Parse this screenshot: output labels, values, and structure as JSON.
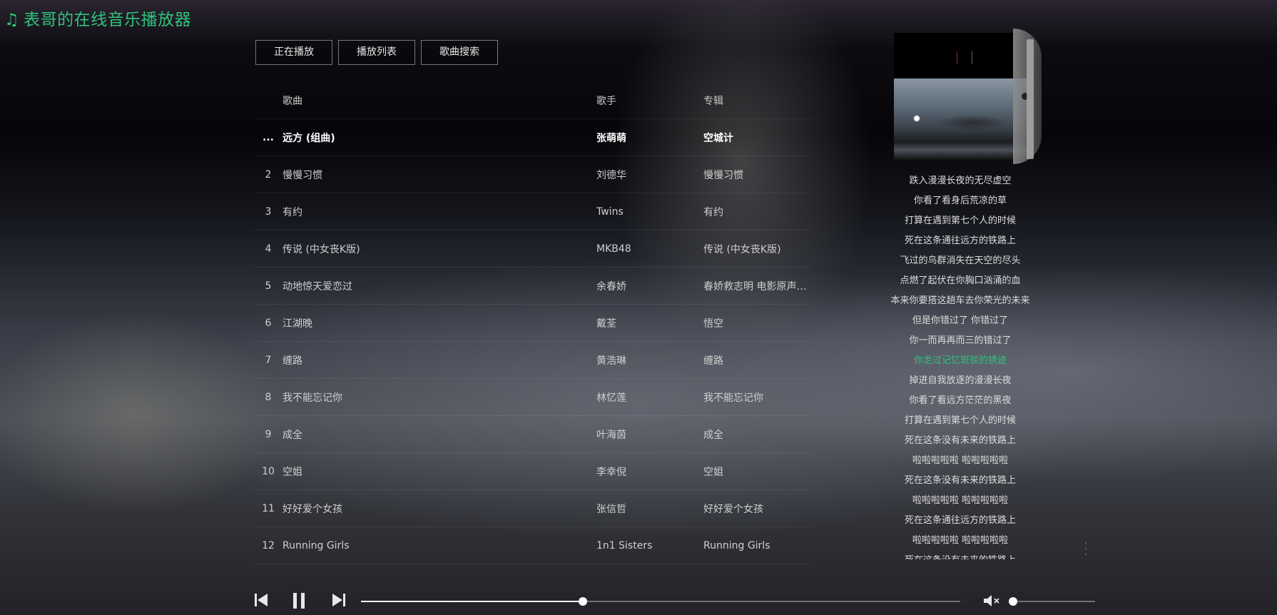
{
  "app": {
    "title": "表哥的在线音乐播放器",
    "accent_color": "#31c27c"
  },
  "tabs": [
    {
      "label": "正在播放"
    },
    {
      "label": "播放列表"
    },
    {
      "label": "歌曲搜索"
    }
  ],
  "song_list": {
    "headers": {
      "name": "歌曲",
      "artist": "歌手",
      "album": "专辑"
    },
    "playing_indicator": "...",
    "rows": [
      {
        "num": "",
        "name": "远方 (组曲)",
        "artist": "张萌萌",
        "album": "空城计",
        "playing": true
      },
      {
        "num": "2",
        "name": "慢慢习惯",
        "artist": "刘德华",
        "album": "慢慢习惯"
      },
      {
        "num": "3",
        "name": "有约",
        "artist": "Twins",
        "album": "有约"
      },
      {
        "num": "4",
        "name": "传说 (中女丧K版)",
        "artist": "MKB48",
        "album": "传说 (中女丧K版)"
      },
      {
        "num": "5",
        "name": "动地惊天爱恋过",
        "artist": "余春娇",
        "album": "春娇救志明 电影原声大.."
      },
      {
        "num": "6",
        "name": "江湖晚",
        "artist": "戴荃",
        "album": "悟空"
      },
      {
        "num": "7",
        "name": "缠路",
        "artist": "黄浩琳",
        "album": "缠路"
      },
      {
        "num": "8",
        "name": "我不能忘记你",
        "artist": "林忆莲",
        "album": "我不能忘记你"
      },
      {
        "num": "9",
        "name": "成全",
        "artist": "叶海茵",
        "album": "成全"
      },
      {
        "num": "10",
        "name": "空姐",
        "artist": "李幸倪",
        "album": "空姐"
      },
      {
        "num": "11",
        "name": "好好爱个女孩",
        "artist": "张信哲",
        "album": "好好爱个女孩"
      },
      {
        "num": "12",
        "name": "Running Girls",
        "artist": "1n1 Sisters",
        "album": "Running Girls"
      }
    ]
  },
  "lyrics": {
    "active_index": 9,
    "lines": [
      "跌入漫漫长夜的无尽虚空",
      "你看了看身后荒凉的草",
      "打算在遇到第七个人的时候",
      "死在这条通往远方的铁路上",
      "飞过的鸟群消失在天空的尽头",
      "点燃了起伏在你胸口汹涌的血",
      "本来你要搭这趟车去你荣光的未来",
      "但是你错过了 你错过了",
      "你一而再再而三的错过了",
      "你走过记忆斑驳的锈迹",
      "掉进自我放逐的漫漫长夜",
      "你看了看远方茫茫的黑夜",
      "打算在遇到第七个人的时候",
      "死在这条没有未来的铁路上",
      "啦啦啦啦啦 啦啦啦啦啦",
      "死在这条没有未来的铁路上",
      "啦啦啦啦啦 啦啦啦啦啦",
      "死在这条通往远方的铁路上",
      "啦啦啦啦啦 啦啦啦啦啦",
      "死在这条没有未来的铁路上"
    ]
  },
  "player": {
    "progress_fraction": 0.37,
    "volume_fraction": 0.04,
    "muted": true
  }
}
